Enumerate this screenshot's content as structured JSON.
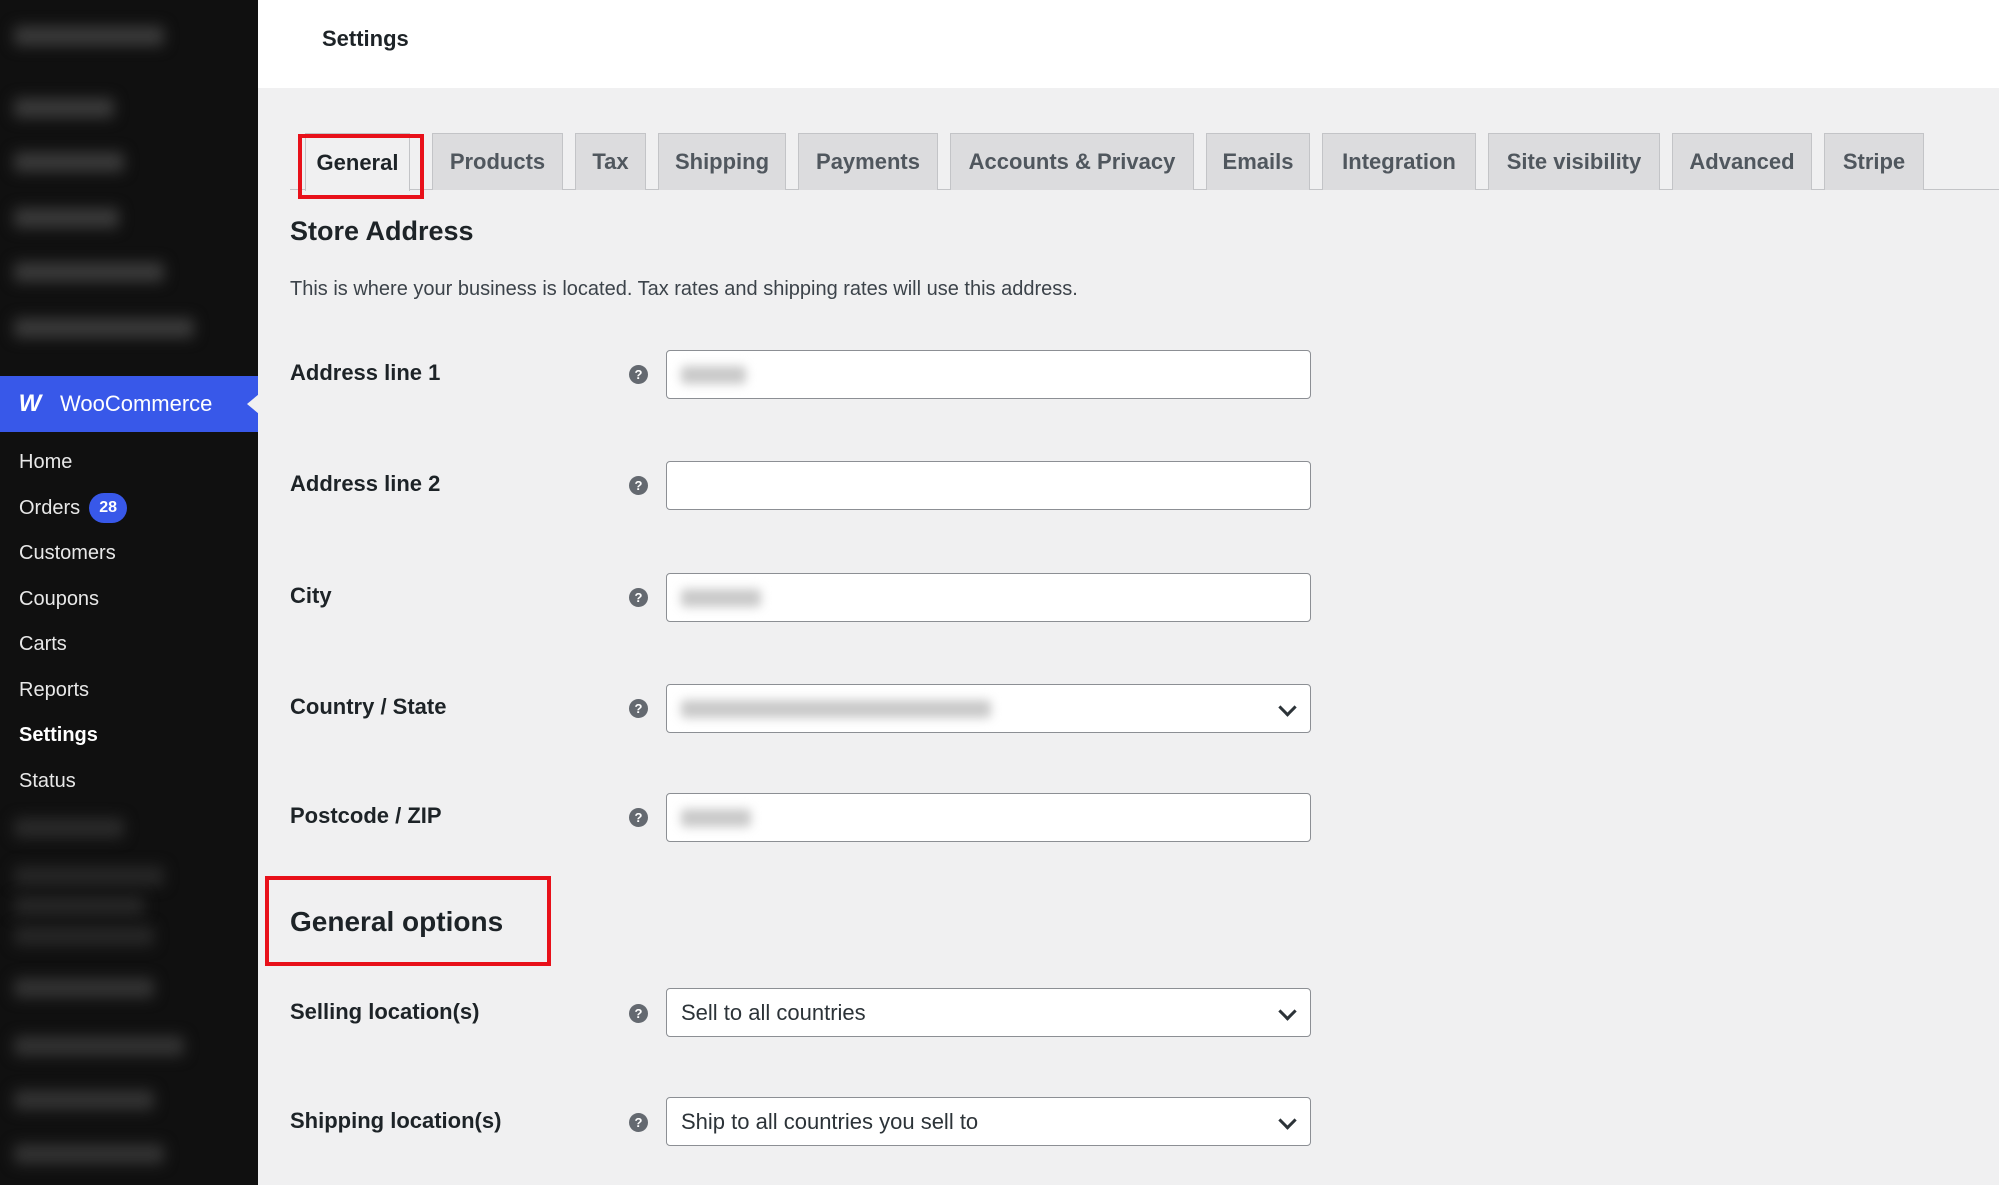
{
  "header": {
    "title": "Settings"
  },
  "sidebar": {
    "plugin": {
      "label": "WooCommerce",
      "icon": "woocommerce-logo-icon"
    },
    "items": [
      {
        "label": "Home"
      },
      {
        "label": "Orders",
        "badge": "28"
      },
      {
        "label": "Customers"
      },
      {
        "label": "Coupons"
      },
      {
        "label": "Carts"
      },
      {
        "label": "Reports"
      },
      {
        "label": "Settings"
      },
      {
        "label": "Status"
      }
    ],
    "accent_color": "#3858e9"
  },
  "tabs": [
    {
      "label": "General"
    },
    {
      "label": "Products"
    },
    {
      "label": "Tax"
    },
    {
      "label": "Shipping"
    },
    {
      "label": "Payments"
    },
    {
      "label": "Accounts & Privacy"
    },
    {
      "label": "Emails"
    },
    {
      "label": "Integration"
    },
    {
      "label": "Site visibility"
    },
    {
      "label": "Advanced"
    },
    {
      "label": "Stripe"
    }
  ],
  "store_address": {
    "title": "Store Address",
    "description": "This is where your business is located. Tax rates and shipping rates will use this address.",
    "fields": {
      "address1": {
        "label": "Address line 1",
        "help": "?"
      },
      "address2": {
        "label": "Address line 2",
        "help": "?"
      },
      "city": {
        "label": "City",
        "help": "?"
      },
      "country": {
        "label": "Country / State",
        "help": "?"
      },
      "postcode": {
        "label": "Postcode / ZIP",
        "help": "?"
      }
    }
  },
  "general_options": {
    "title": "General options",
    "fields": {
      "selling": {
        "label": "Selling location(s)",
        "help": "?",
        "value": "Sell to all countries"
      },
      "shipping": {
        "label": "Shipping location(s)",
        "help": "?",
        "value": "Ship to all countries you sell to"
      }
    }
  },
  "highlight_color": "#e8101a"
}
